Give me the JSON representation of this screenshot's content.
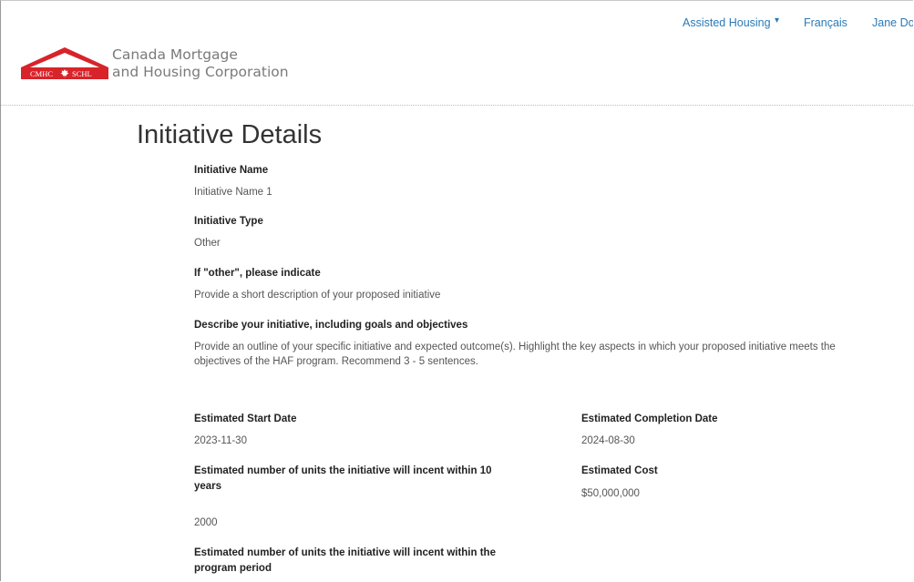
{
  "header": {
    "logo": {
      "abbr_en": "CMHC",
      "abbr_fr": "SCHL",
      "accent_color": "#d8232a"
    },
    "org_name_line1": "Canada Mortgage",
    "org_name_line2": "and Housing Corporation",
    "nav": {
      "assisted_housing": "Assisted Housing",
      "assisted_housing_caret": "▾",
      "language": "Français",
      "user": "Jane Do"
    },
    "link_color": "#2a7ab8"
  },
  "page": {
    "title": "Initiative Details",
    "fields": {
      "initiative_name": {
        "label": "Initiative Name",
        "value": "Initiative Name 1"
      },
      "initiative_type": {
        "label": "Initiative Type",
        "value": "Other"
      },
      "if_other": {
        "label": "If \"other\", please indicate",
        "value": "Provide a short description of your proposed initiative"
      },
      "describe": {
        "label": "Describe your initiative, including goals and objectives",
        "value_line1": "Provide an outline of your specific initiative and expected outcome(s). Highlight the key aspects in which your proposed initiative meets the",
        "value_line2": "objectives of the HAF program. Recommend 3 - 5 sentences."
      },
      "start_date": {
        "label": "Estimated Start Date",
        "value": "2023-11-30"
      },
      "completion_date": {
        "label": "Estimated Completion Date",
        "value": "2024-08-30"
      },
      "units_10_years": {
        "label_line1": "Estimated number of units the initiative will incent within 10",
        "label_line2": "years",
        "value": "2000"
      },
      "estimated_cost": {
        "label": "Estimated Cost",
        "value": "$50,000,000"
      },
      "units_program_period": {
        "label_line1": "Estimated number of units the initiative will incent within the",
        "label_line2": "program period"
      }
    }
  }
}
